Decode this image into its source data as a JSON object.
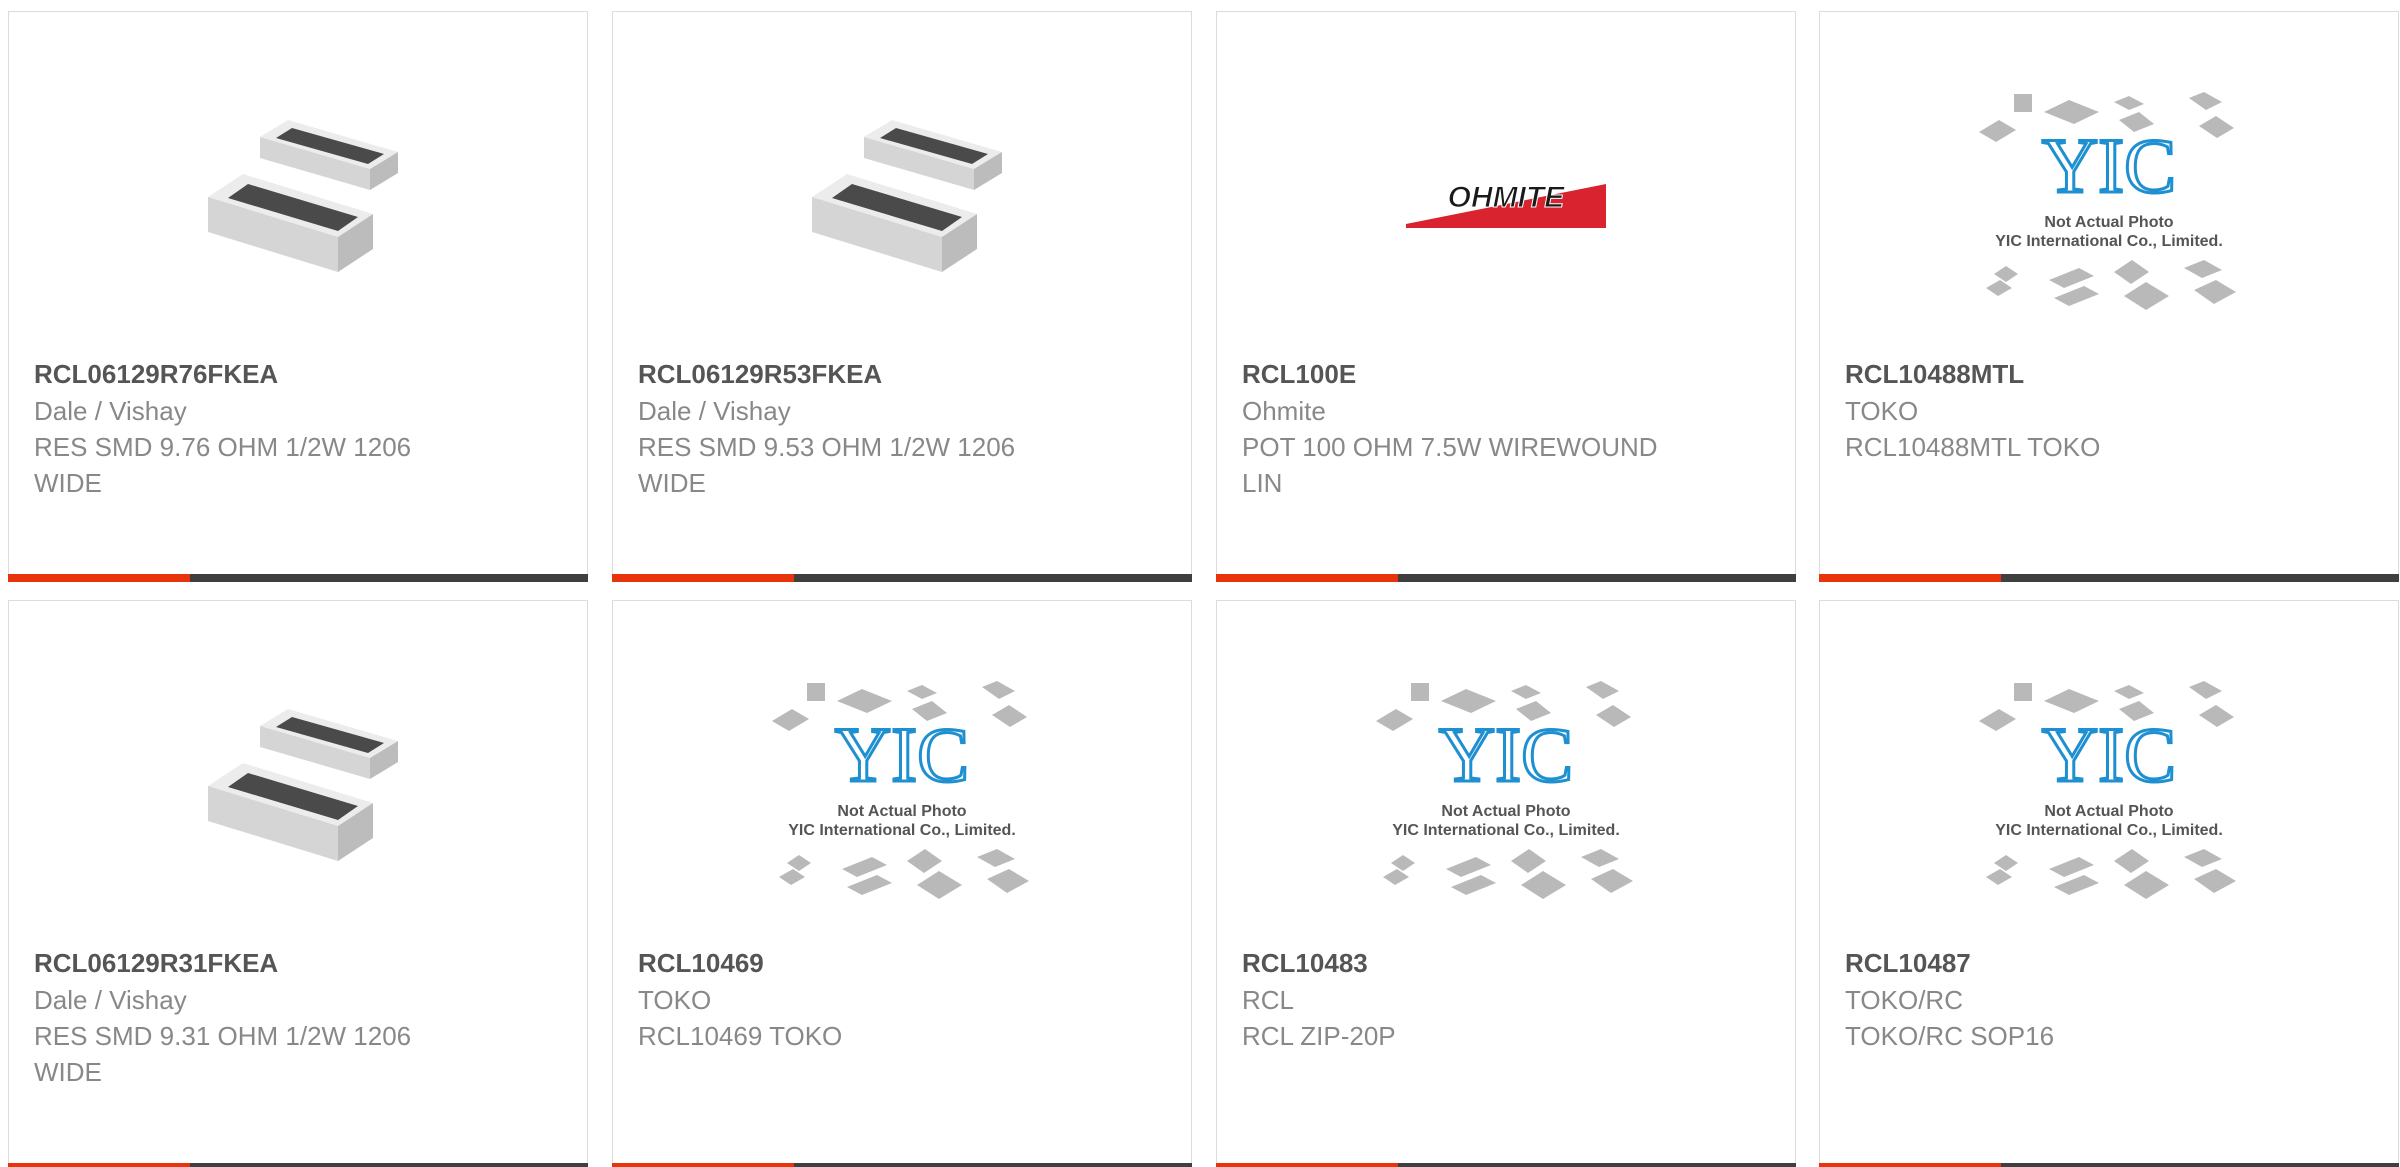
{
  "products": [
    {
      "part": "RCL06129R76FKEA",
      "manufacturer": "Dale / Vishay",
      "description": "RES SMD 9.76 OHM 1/2W 1206 WIDE",
      "image": "smd-resistor-photo"
    },
    {
      "part": "RCL06129R53FKEA",
      "manufacturer": "Dale / Vishay",
      "description": "RES SMD 9.53 OHM 1/2W 1206 WIDE",
      "image": "smd-resistor-photo"
    },
    {
      "part": "RCL100E",
      "manufacturer": "Ohmite",
      "description": "POT 100 OHM 7.5W WIREWOUND LIN",
      "image": "ohmite-logo",
      "logo_text": "OHMITE"
    },
    {
      "part": "RCL10488MTL",
      "manufacturer": "TOKO",
      "description": "RCL10488MTL TOKO",
      "image": "yic-placeholder",
      "placeholder_line1": "Not Actual Photo",
      "placeholder_line2": "YIC International Co., Limited."
    },
    {
      "part": "RCL06129R31FKEA",
      "manufacturer": "Dale / Vishay",
      "description": "RES SMD 9.31 OHM 1/2W 1206 WIDE",
      "image": "smd-resistor-photo"
    },
    {
      "part": "RCL10469",
      "manufacturer": "TOKO",
      "description": "RCL10469 TOKO",
      "image": "yic-placeholder",
      "placeholder_line1": "Not Actual Photo",
      "placeholder_line2": "YIC International Co., Limited."
    },
    {
      "part": "RCL10483",
      "manufacturer": "RCL",
      "description": "RCL ZIP-20P",
      "image": "yic-placeholder",
      "placeholder_line1": "Not Actual Photo",
      "placeholder_line2": "YIC International Co., Limited."
    },
    {
      "part": "RCL10487",
      "manufacturer": "TOKO/RC",
      "description": "TOKO/RC SOP16",
      "image": "yic-placeholder",
      "placeholder_line1": "Not Actual Photo",
      "placeholder_line2": "YIC International Co., Limited."
    }
  ],
  "colors": {
    "accent": "#e8340c",
    "bar": "#3f3f3f",
    "part_text": "#555555",
    "meta_text": "#888888",
    "yic_blue": "#1e8fd0",
    "ohmite_red": "#d9232e"
  }
}
